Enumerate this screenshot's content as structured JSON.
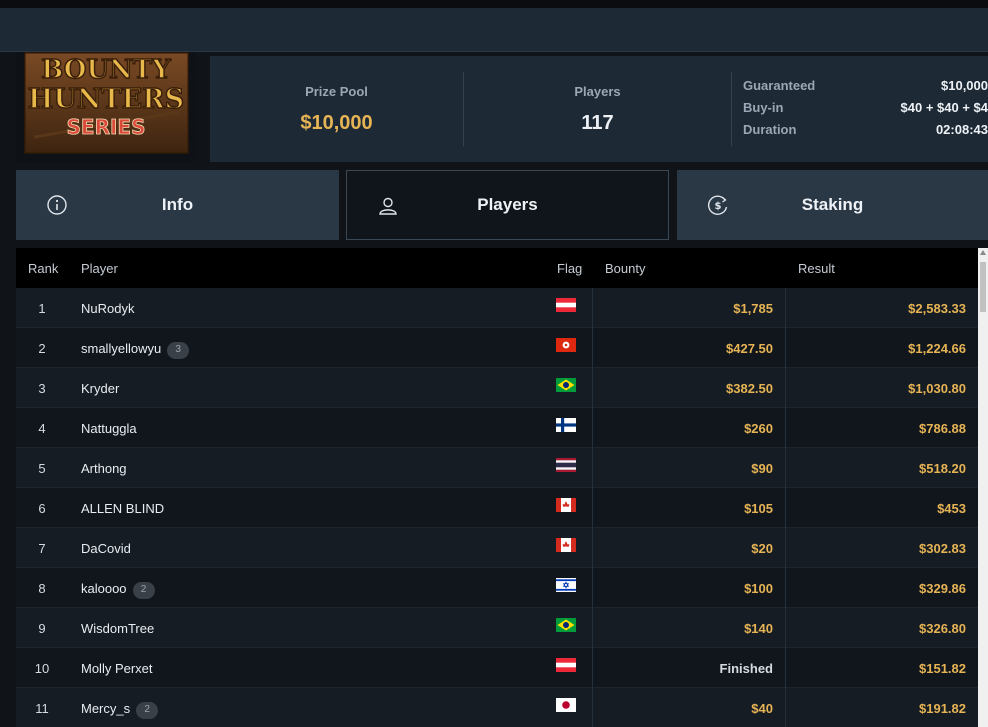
{
  "header": {
    "prize_pool_label": "Prize Pool",
    "prize_pool_value": "$10,000",
    "players_label": "Players",
    "players_value": "117",
    "details": [
      {
        "label": "Guaranteed",
        "value": "$10,000"
      },
      {
        "label": "Buy-in",
        "value": "$40 + $40 + $4"
      },
      {
        "label": "Duration",
        "value": "02:08:43"
      }
    ]
  },
  "logo": {
    "line1": "BOUNTY",
    "line2": "HUNTERS",
    "line3": "SERIES"
  },
  "tabs": [
    {
      "label": "Info",
      "icon": "info-icon",
      "active": false
    },
    {
      "label": "Players",
      "icon": "user-icon",
      "active": true
    },
    {
      "label": "Staking",
      "icon": "dollar-coin-icon",
      "active": false
    }
  ],
  "table": {
    "columns": {
      "rank": "Rank",
      "player": "Player",
      "flag": "Flag",
      "bounty": "Bounty",
      "result": "Result"
    },
    "rows": [
      {
        "rank": "1",
        "player": "NuRodyk",
        "badge": "",
        "flag": "austria",
        "bounty": "$1,785",
        "result": "$2,583.33"
      },
      {
        "rank": "2",
        "player": "smallyellowyu",
        "badge": "3",
        "flag": "hongkong",
        "bounty": "$427.50",
        "result": "$1,224.66"
      },
      {
        "rank": "3",
        "player": "Kryder",
        "badge": "",
        "flag": "brazil",
        "bounty": "$382.50",
        "result": "$1,030.80"
      },
      {
        "rank": "4",
        "player": "Nattuggla",
        "badge": "",
        "flag": "finland",
        "bounty": "$260",
        "result": "$786.88"
      },
      {
        "rank": "5",
        "player": "Arthong",
        "badge": "",
        "flag": "thailand",
        "bounty": "$90",
        "result": "$518.20"
      },
      {
        "rank": "6",
        "player": "ALLEN BLIND",
        "badge": "",
        "flag": "canada",
        "bounty": "$105",
        "result": "$453"
      },
      {
        "rank": "7",
        "player": "DaCovid",
        "badge": "",
        "flag": "canada",
        "bounty": "$20",
        "result": "$302.83"
      },
      {
        "rank": "8",
        "player": "kaloooo",
        "badge": "2",
        "flag": "israel",
        "bounty": "$100",
        "result": "$329.86"
      },
      {
        "rank": "9",
        "player": "WisdomTree",
        "badge": "",
        "flag": "brazil",
        "bounty": "$140",
        "result": "$326.80"
      },
      {
        "rank": "10",
        "player": "Molly Perxet",
        "badge": "",
        "flag": "austria",
        "bounty": "Finished",
        "result": "$151.82"
      },
      {
        "rank": "11",
        "player": "Mercy_s",
        "badge": "2",
        "flag": "japan",
        "bounty": "$40",
        "result": "$191.82"
      }
    ]
  },
  "colors": {
    "accent_gold": "#e6b455",
    "panel": "#1d2935",
    "tab": "#2a3745"
  }
}
